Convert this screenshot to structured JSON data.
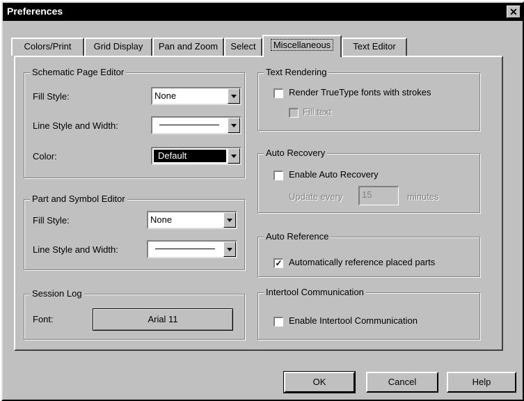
{
  "window": {
    "title": "Preferences",
    "close_glyph": "✕"
  },
  "tabs": [
    {
      "label": "Colors/Print"
    },
    {
      "label": "Grid Display"
    },
    {
      "label": "Pan and Zoom"
    },
    {
      "label": "Select"
    },
    {
      "label": "Miscellaneous",
      "active": true
    },
    {
      "label": "Text Editor"
    }
  ],
  "schematic": {
    "title": "Schematic Page Editor",
    "fill_label": "Fill Style:",
    "fill_value": "None",
    "line_label": "Line Style and Width:",
    "color_label": "Color:",
    "color_value": "Default"
  },
  "part": {
    "title": "Part and Symbol Editor",
    "fill_label": "Fill Style:",
    "fill_value": "None",
    "line_label": "Line Style and Width:"
  },
  "session": {
    "title": "Session Log",
    "font_label": "Font:",
    "font_value": "Arial 11"
  },
  "text_rendering": {
    "title": "Text Rendering",
    "render_label": "Render TrueType fonts with strokes",
    "render_checked": false,
    "fill_text_label": "Fill text",
    "fill_text_checked": false
  },
  "auto_recovery": {
    "title": "Auto Recovery",
    "enable_label": "Enable Auto Recovery",
    "enable_checked": false,
    "update_label": "Update every",
    "update_value": "15",
    "minutes_label": "minutes"
  },
  "auto_reference": {
    "title": "Auto Reference",
    "label": "Automatically reference placed parts",
    "checked": true
  },
  "intertool": {
    "title": "Intertool Communication",
    "label": "Enable Intertool Communication",
    "checked": false
  },
  "buttons": {
    "ok": "OK",
    "cancel": "Cancel",
    "help": "Help"
  },
  "colors": {
    "face": "#c0c0c0",
    "title_bar": "#000000",
    "disabled_text": "#808080"
  }
}
